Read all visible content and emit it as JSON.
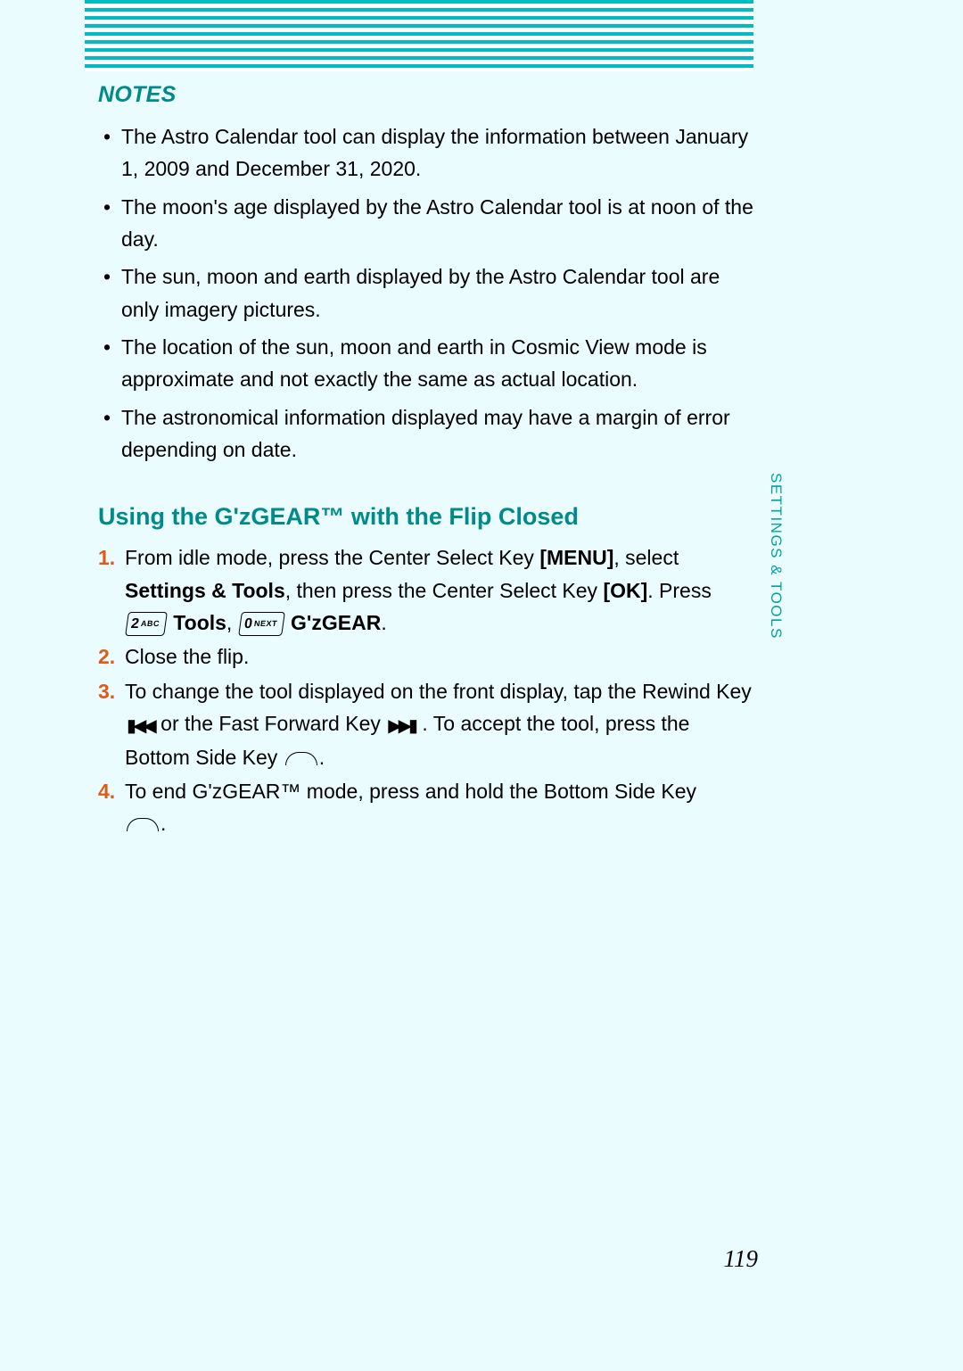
{
  "notes_heading": "NOTES",
  "notes": [
    "The Astro Calendar tool can display the information between January 1, 2009 and December 31, 2020.",
    "The moon's age displayed by the Astro Calendar tool is at noon of the day.",
    "The sun, moon and earth displayed by the Astro Calendar tool are only imagery pictures.",
    "The location of the sun, moon and earth in Cosmic View mode is approximate and not exactly the same as actual location.",
    "The astronomical information displayed may have a margin of error depending on date."
  ],
  "section_heading": "Using the G'zGEAR™ with the Flip Closed",
  "steps": {
    "s1": {
      "t1": "From idle mode, press the Center Select Key ",
      "menu": "[MENU]",
      "t2": ", select ",
      "settings_tools": "Settings & Tools",
      "t3": ", then press the Center Select Key ",
      "ok": "[OK]",
      "t4": ". Press ",
      "key2_big": "2",
      "key2_tiny": "ABC",
      "tools": " Tools",
      "comma": ", ",
      "key0_big": "0",
      "key0_tiny": "NEXT",
      "gzgear": " G'zGEAR",
      "period": "."
    },
    "s2": "Close the flip.",
    "s3": {
      "t1": "To change the tool displayed on the front display, tap the Rewind Key ",
      "t2": " or the Fast Forward Key ",
      "t3": " . To accept the tool, press the Bottom Side Key ",
      "t4": "."
    },
    "s4": {
      "t1": "To end G'zGEAR™ mode, press and hold the Bottom Side Key ",
      "t2": "."
    }
  },
  "side_tab": "SETTINGS & TOOLS",
  "page_number": "119"
}
